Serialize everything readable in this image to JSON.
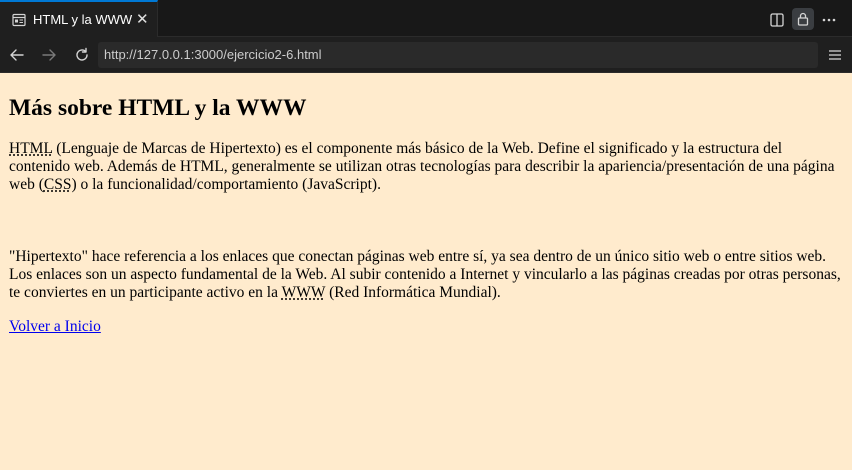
{
  "browser": {
    "tab_title": "HTML y la WWW",
    "tab_close": "✕",
    "url": "http://127.0.0.1:3000/ejercicio2-6.html",
    "icons": [
      "page-icon",
      "split-view-icon",
      "lock-icon",
      "more-icon",
      "back-icon",
      "forward-icon",
      "reload-icon",
      "menu-icon"
    ],
    "accent": "#0078d4"
  },
  "page": {
    "heading": "Más sobre HTML y la WWW",
    "background": "#ffebcd",
    "p1": {
      "abbr_html": "HTML",
      "text_a": " (Lenguaje de Marcas de Hipertexto) es el componente más básico de la Web. Define el significado y la estructura del contenido web. Además de HTML, generalmente se utilizan otras tecnologías para describir la apariencia/presentación de una página web (",
      "abbr_css": "CSS",
      "text_b": ") o la funcionalidad/comportamiento (JavaScript)."
    },
    "p2": {
      "text_a": "\"Hipertexto\" hace referencia a los enlaces que conectan páginas web entre sí, ya sea dentro de un único sitio web o entre sitios web. Los enlaces son un aspecto fundamental de la Web. Al subir contenido a Internet y vincularlo a las páginas creadas por otras personas, te conviertes en un participante activo en la ",
      "abbr_www": "WWW",
      "text_b": " (Red Informática Mundial)."
    },
    "link_home": "Volver a Inicio"
  }
}
